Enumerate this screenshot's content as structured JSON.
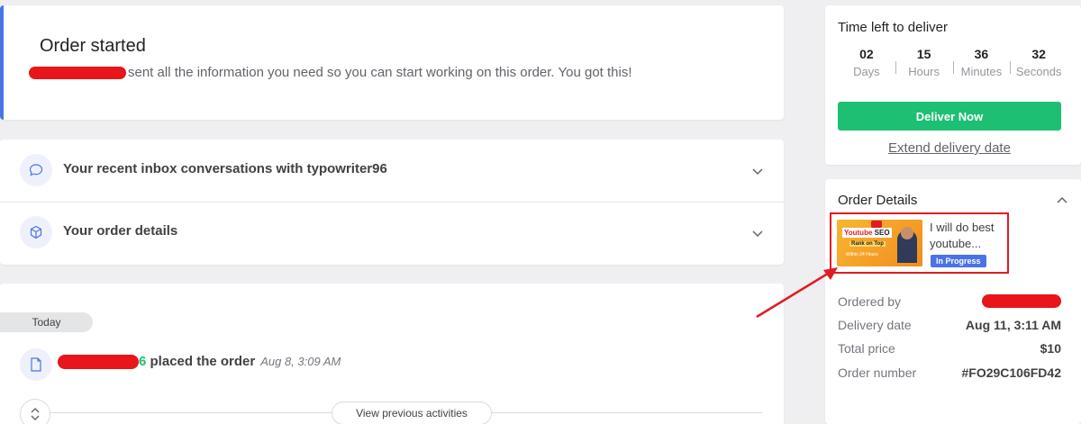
{
  "banner": {
    "title": "Order started",
    "message": "sent all the information you need so you can start working on this order. You got this!"
  },
  "accordion": {
    "items": [
      {
        "label": "Your recent inbox conversations with typowriter96",
        "icon": "chat-bubble-icon"
      },
      {
        "label": "Your order details",
        "icon": "package-box-icon"
      }
    ]
  },
  "activity": {
    "day_label": "Today",
    "event_suffix": "6",
    "event_text": "placed the order",
    "event_time": "Aug 8, 3:09 AM",
    "view_previous": "View previous activities"
  },
  "timer": {
    "title": "Time left to deliver",
    "units": [
      {
        "value": "02",
        "label": "Days"
      },
      {
        "value": "15",
        "label": "Hours"
      },
      {
        "value": "36",
        "label": "Minutes"
      },
      {
        "value": "32",
        "label": "Seconds"
      }
    ],
    "deliver_button": "Deliver Now",
    "extend_link": "Extend delivery date"
  },
  "order_details": {
    "title": "Order Details",
    "gig_title": "I will do best youtube...",
    "status": "In Progress",
    "thumbnail": {
      "line1_prefix": "Youtube",
      "line1_suffix": "SEO",
      "line2": "Rank on Top",
      "line3": "Within 24 Hours"
    },
    "rows": [
      {
        "label": "Ordered by",
        "value": ""
      },
      {
        "label": "Delivery date",
        "value": "Aug 11, 3:11 AM"
      },
      {
        "label": "Total price",
        "value": "$10"
      },
      {
        "label": "Order number",
        "value": "#FO29C106FD42"
      }
    ]
  },
  "colors": {
    "accent_blue": "#4a73e8",
    "deliver_green": "#1dbf73",
    "annotation_red": "#e11b22"
  }
}
